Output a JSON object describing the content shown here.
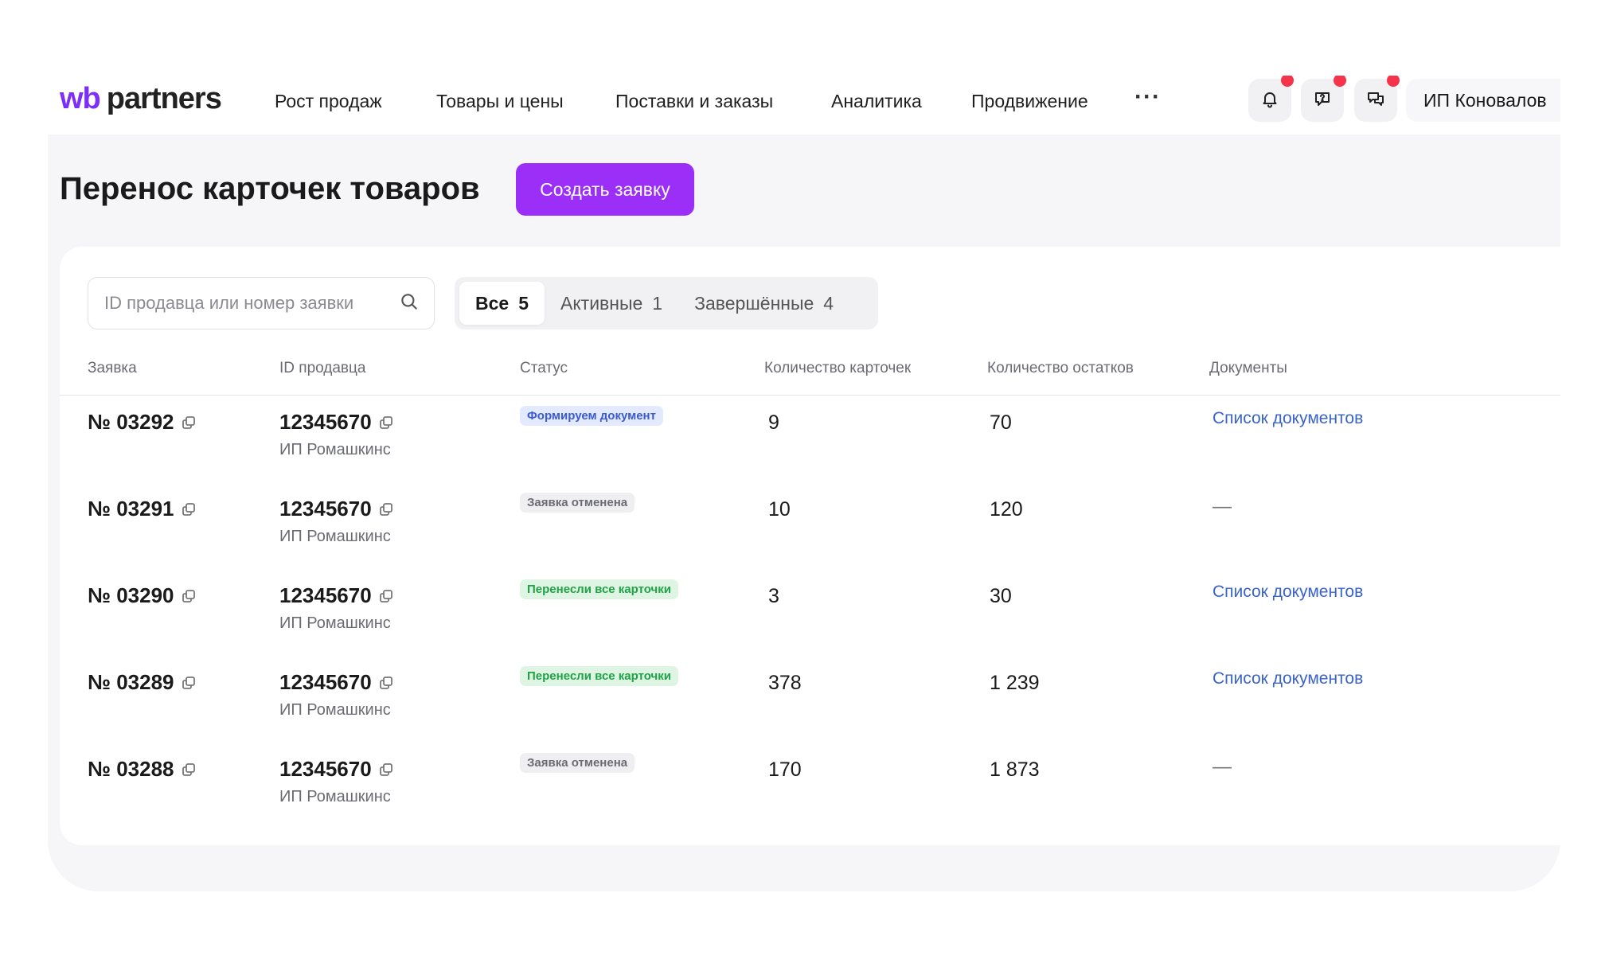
{
  "header": {
    "logo_wb": "wb",
    "logo_partners": "partners",
    "nav": [
      {
        "label": "Рост продаж"
      },
      {
        "label": "Товары и цены"
      },
      {
        "label": "Поставки и заказы"
      },
      {
        "label": "Аналитика"
      },
      {
        "label": "Продвижение"
      }
    ],
    "more": "···",
    "icons": [
      "bell-icon",
      "question-bubble-icon",
      "chat-icon"
    ],
    "profile_name": "ИП Коновалов"
  },
  "page": {
    "title": "Перенос карточек товаров",
    "create_button": "Создать заявку"
  },
  "search": {
    "placeholder": "ID продавца или номер заявки"
  },
  "tabs": [
    {
      "label": "Все",
      "count": "5"
    },
    {
      "label": "Активные",
      "count": "1"
    },
    {
      "label": "Завершённые",
      "count": "4"
    }
  ],
  "table": {
    "headers": {
      "request": "Заявка",
      "seller_id": "ID продавца",
      "status": "Статус",
      "cards": "Количество карточек",
      "stock": "Количество остатков",
      "documents": "Документы"
    },
    "rows": [
      {
        "request": "№ 03292",
        "seller_id": "12345670",
        "seller_name": "ИП Ромашкинс",
        "status": "Формируем документ",
        "status_kind": "blue",
        "cards": "9",
        "stock": "70",
        "documents": "Список документов"
      },
      {
        "request": "№ 03291",
        "seller_id": "12345670",
        "seller_name": "ИП Ромашкинс",
        "status": "Заявка отменена",
        "status_kind": "gray",
        "cards": "10",
        "stock": "120",
        "documents": "—"
      },
      {
        "request": "№ 03290",
        "seller_id": "12345670",
        "seller_name": "ИП Ромашкинс",
        "status": "Перенесли все карточки",
        "status_kind": "green",
        "cards": "3",
        "stock": "30",
        "documents": "Список документов"
      },
      {
        "request": "№ 03289",
        "seller_id": "12345670",
        "seller_name": "ИП Ромашкинс",
        "status": "Перенесли все карточки",
        "status_kind": "green",
        "cards": "378",
        "stock": "1 239",
        "documents": "Список документов"
      },
      {
        "request": "№ 03288",
        "seller_id": "12345670",
        "seller_name": "ИП Ромашкинс",
        "status": "Заявка отменена",
        "status_kind": "gray",
        "cards": "170",
        "stock": "1 873",
        "documents": "—"
      }
    ]
  },
  "colors": {
    "brand": "#9c2ff7",
    "link": "#3a63c9",
    "badge_blue_bg": "#e3eaff",
    "badge_gray_bg": "#efeff2",
    "badge_green_bg": "#def5e4",
    "notification_dot": "#f5334a"
  }
}
